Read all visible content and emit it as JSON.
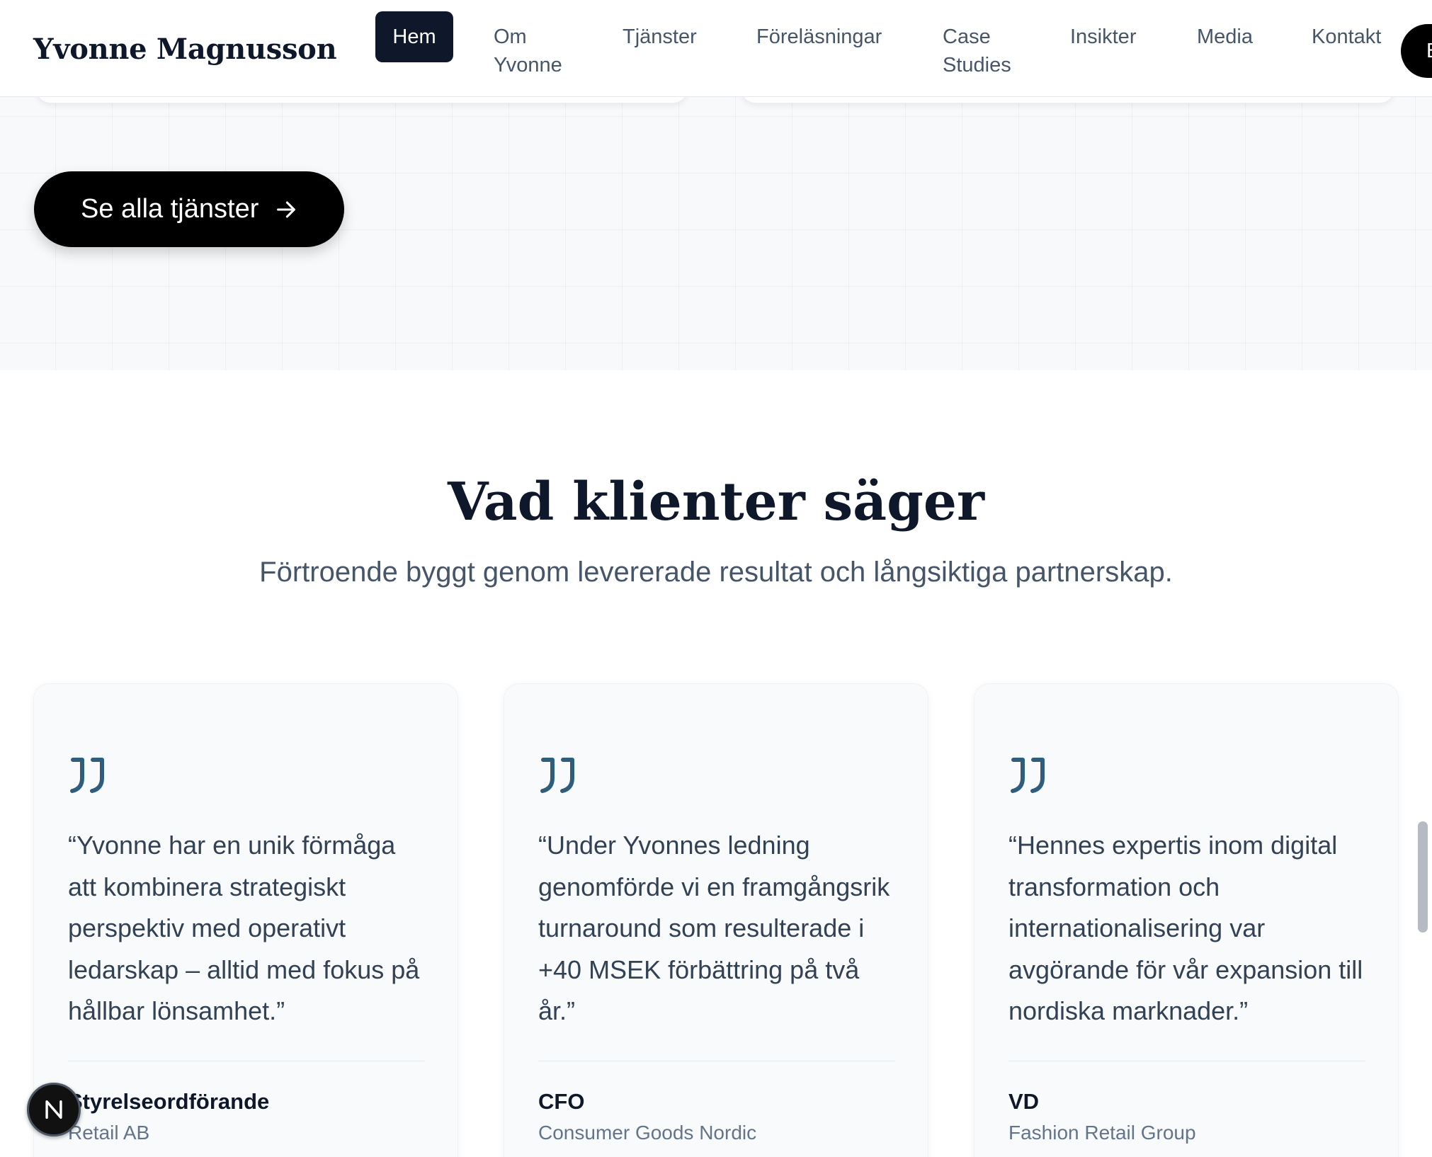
{
  "header": {
    "brand": "Yvonne Magnusson",
    "nav": [
      {
        "label": "Hem",
        "active": true
      },
      {
        "label": "Om Yvonne"
      },
      {
        "label": "Tjänster"
      },
      {
        "label": "Föreläsningar"
      },
      {
        "label": "Case Studies"
      },
      {
        "label": "Insikter"
      },
      {
        "label": "Media"
      },
      {
        "label": "Kontakt"
      }
    ],
    "edge_button": "B"
  },
  "services": {
    "cta_label": "Se alla tjänster"
  },
  "testimonials": {
    "title": "Vad klienter säger",
    "subtitle": "Förtroende byggt genom levererade resultat och långsiktiga partnerskap.",
    "items": [
      {
        "quote": "“Yvonne har en unik förmåga att kombinera strategiskt perspektiv med operativt ledarskap – alltid med fokus på hållbar lönsamhet.”",
        "role": "Styrelseordförande",
        "company": "Retail AB"
      },
      {
        "quote": "“Under Yvonnes ledning genomförde vi en framgångsrik turnaround som resulterade i +40 MSEK förbättring på två år.”",
        "role": "CFO",
        "company": "Consumer Goods Nordic"
      },
      {
        "quote": "“Hennes expertis inom digital transformation och internationalisering var avgörande för vår expansion till nordiska marknader.”",
        "role": "VD",
        "company": "Fashion Retail Group"
      }
    ]
  },
  "dev_badge": "N",
  "colors": {
    "navy": "#0f172a",
    "quote_icon": "#2f5d7c",
    "muted_text": "#475569"
  }
}
